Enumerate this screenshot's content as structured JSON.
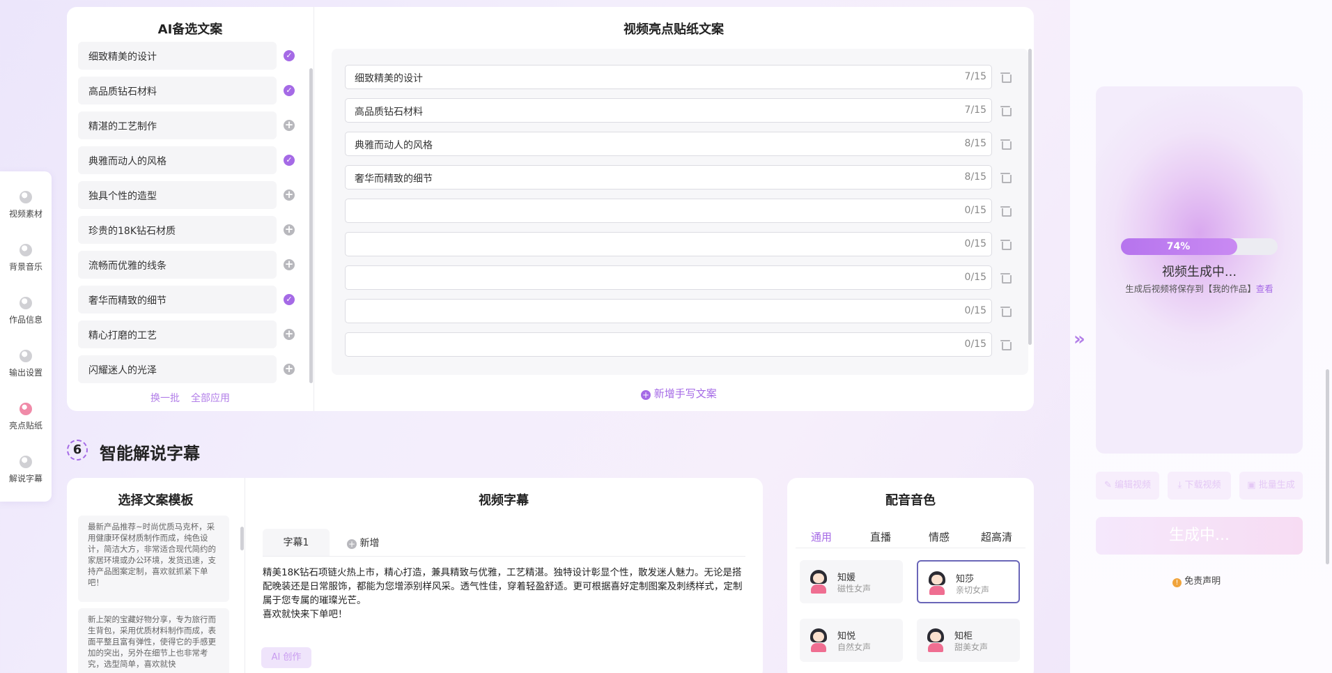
{
  "sidenav": {
    "items": [
      {
        "label": "视频素材",
        "icon": "video-material-icon"
      },
      {
        "label": "背景音乐",
        "icon": "music-icon"
      },
      {
        "label": "作品信息",
        "icon": "info-icon"
      },
      {
        "label": "输出设置",
        "icon": "settings-icon"
      },
      {
        "label": "亮点贴纸",
        "icon": "sticker-icon"
      },
      {
        "label": "解说字幕",
        "icon": "subtitle-icon"
      }
    ]
  },
  "candidates": {
    "title": "AI备选文案",
    "items": [
      {
        "text": "细致精美的设计",
        "selected": true
      },
      {
        "text": "高品质钻石材料",
        "selected": true
      },
      {
        "text": "精湛的工艺制作",
        "selected": false
      },
      {
        "text": "典雅而动人的风格",
        "selected": true
      },
      {
        "text": "独具个性的造型",
        "selected": false
      },
      {
        "text": "珍贵的18K钻石材质",
        "selected": false
      },
      {
        "text": "流畅而优雅的线条",
        "selected": false
      },
      {
        "text": "奢华而精致的细节",
        "selected": true
      },
      {
        "text": "精心打磨的工艺",
        "selected": false
      },
      {
        "text": "闪耀迷人的光泽",
        "selected": false
      }
    ],
    "refresh_label": "换一批",
    "apply_all_label": "全部应用"
  },
  "stickers": {
    "title": "视频亮点贴纸文案",
    "rows": [
      {
        "text": "细致精美的设计",
        "count": "7/15"
      },
      {
        "text": "高品质钻石材料",
        "count": "7/15"
      },
      {
        "text": "典雅而动人的风格",
        "count": "8/15"
      },
      {
        "text": "奢华而精致的细节",
        "count": "8/15"
      },
      {
        "text": "",
        "count": "0/15"
      },
      {
        "text": "",
        "count": "0/15"
      },
      {
        "text": "",
        "count": "0/15"
      },
      {
        "text": "",
        "count": "0/15"
      },
      {
        "text": "",
        "count": "0/15"
      }
    ],
    "add_label": "新增手写文案"
  },
  "section6": {
    "number": "6",
    "title": "智能解说字幕"
  },
  "templates": {
    "title": "选择文案模板",
    "items": [
      "最新产品推荐~时尚优质马克杯，采用健康环保材质制作而成，纯色设计，简洁大方，非常适合现代简约的家居环境或办公环境，发货迅速，支持产品图案定制，喜欢就抓紧下单吧！",
      "新上架的宝藏好物分享，专为旅行而生背包，采用优质材料制作而成，表面平整且富有弹性，使得它的手感更加的突出，另外在细节上也非常考究，选型简单，喜欢就快"
    ]
  },
  "subtitles": {
    "title": "视频字幕",
    "tab_label": "字幕1",
    "add_tab_label": "新增",
    "content": "精美18K钻石项链火热上市，精心打造，兼具精致与优雅，工艺精湛。独特设计彰显个性，散发迷人魅力。无论是搭配晚装还是日常服饰，都能为您增添别样风采。透气性佳，穿着轻盈舒适。更可根据喜好定制图案及刺绣样式，定制属于您专属的璀璨光芒。",
    "content_line2": "喜欢就快来下单吧！",
    "ai_button": "AI 创作"
  },
  "voices": {
    "title": "配音音色",
    "tabs": [
      "通用",
      "直播",
      "情感",
      "超高清"
    ],
    "active_tab": "通用",
    "items": [
      {
        "name": "知媛",
        "desc": "磁性女声",
        "selected": false
      },
      {
        "name": "知莎",
        "desc": "亲切女声",
        "selected": true
      },
      {
        "name": "知悦",
        "desc": "自然女声",
        "selected": false
      },
      {
        "name": "知柜",
        "desc": "甜美女声",
        "selected": false
      }
    ]
  },
  "preview": {
    "progress": 0.74,
    "progress_label": "74%",
    "status": "视频生成中...",
    "hint": "生成后视频将保存到【我的作品】",
    "hint_link": "查看",
    "buttons": [
      "编辑视频",
      "下载视频",
      "批量生成"
    ],
    "generate_label": "生成中...",
    "disclaimer": "免责声明"
  },
  "colors": {
    "accent": "#a56ae6",
    "voice_selected_border": "#6a66b8"
  }
}
